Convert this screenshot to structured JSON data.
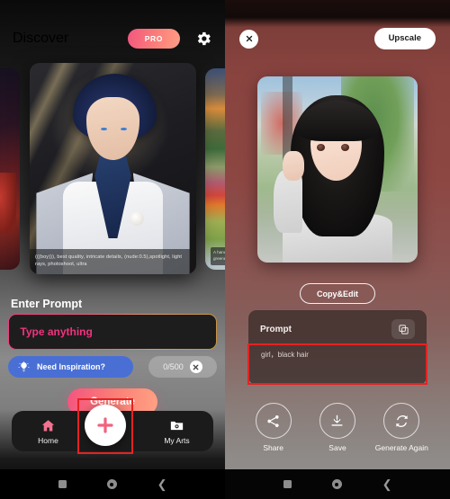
{
  "left_panel": {
    "header": {
      "title": "Discover",
      "pro_label": "PRO",
      "settings_icon": "gear-icon"
    },
    "carousel": {
      "main_card": {
        "caption": "(((boy))), best quality, intricate details, (nude:0.5),spotlight, light rays, photoshoot, ultra",
        "image_alt": "anime man with dark blue hair in light gray suit with navy cravat and white rose"
      },
      "left_card": {
        "image_alt": "dark red fantasy artwork, partially visible"
      },
      "right_card": {
        "caption": "A handso greenest",
        "image_alt": "sunset landscape with colorful fields and flowers"
      }
    },
    "enter_prompt_label": "Enter Prompt",
    "prompt_input": {
      "value": "",
      "placeholder": "Type anything"
    },
    "inspiration_button": {
      "label": "Need Inspiration?",
      "icon": "lightbulb-icon",
      "color": "#4a6fd4"
    },
    "counter": {
      "text": "0/500",
      "clear_icon": "close-circle-icon"
    },
    "generate_button": {
      "label": "Generate",
      "gradient_from": "#f4547f",
      "gradient_to": "#ffa183"
    },
    "tabbar": {
      "items": [
        {
          "label": "Home",
          "icon": "home-icon",
          "active": true
        },
        {
          "label": "My Arts",
          "icon": "folder-photo-icon",
          "active": false
        }
      ],
      "fab": {
        "icon": "plus-icon",
        "highlighted": true,
        "highlight_color": "#e52222"
      }
    }
  },
  "right_panel": {
    "close_icon": "close-icon",
    "upscale_button": {
      "label": "Upscale"
    },
    "result_image": {
      "image_alt": "anime girl with long black hair in gray sweater outdoors"
    },
    "copy_edit_button": {
      "label": "Copy&Edit"
    },
    "prompt_card": {
      "title": "Prompt",
      "copy_icon": "copy-icon",
      "text": "girl，black hair",
      "highlighted": true,
      "highlight_color": "#e52222"
    },
    "actions": [
      {
        "label": "Share",
        "icon": "share-icon"
      },
      {
        "label": "Save",
        "icon": "download-icon"
      },
      {
        "label": "Generate Again",
        "icon": "refresh-icon"
      }
    ]
  },
  "system_navbar": {
    "recents_icon": "square-icon",
    "home_icon": "circle-icon",
    "back_icon": "chevron-left-icon"
  }
}
